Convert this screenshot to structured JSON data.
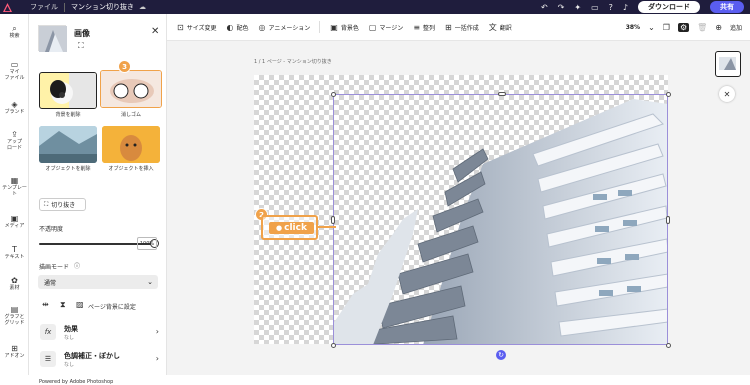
{
  "topbar": {
    "file_label": "ファイル",
    "doc_name": "マンション切り抜き",
    "download_label": "ダウンロード",
    "share_label": "共有"
  },
  "leftnav": [
    {
      "icon": "search-icon",
      "label": "検索"
    },
    {
      "icon": "folder-icon",
      "label": "マイ\nファイル"
    },
    {
      "icon": "brand-icon",
      "label": "ブランド"
    },
    {
      "icon": "upload-icon",
      "label": "アップ\nロード"
    },
    {
      "icon": "template-icon",
      "label": "テンプレート"
    },
    {
      "icon": "media-icon",
      "label": "メディア"
    },
    {
      "icon": "text-icon",
      "label": "テキスト"
    },
    {
      "icon": "elements-icon",
      "label": "素材"
    },
    {
      "icon": "grid-icon",
      "label": "グラフと\nグリッド"
    },
    {
      "icon": "addon-icon",
      "label": "アドオン"
    }
  ],
  "panel": {
    "title": "画像",
    "cards": [
      {
        "label": "背景を削除"
      },
      {
        "label": "消しゴム"
      },
      {
        "label": "オブジェクトを削除"
      },
      {
        "label": "オブジェクトを挿入"
      }
    ],
    "crop_label": "切り抜き",
    "opacity_label": "不透明度",
    "opacity_value": "100%",
    "blend_label": "描画モード",
    "blend_value": "通常",
    "bg_label": "ページ背景に設定",
    "effects_title": "効果",
    "effects_sub": "なし",
    "adjust_title": "色調補正・ぼかし",
    "adjust_sub": "なし",
    "powered": "Powered by Adobe Photoshop"
  },
  "toolbar": {
    "items": [
      "サイズ変更",
      "配色",
      "アニメーション",
      "背景色",
      "マージン",
      "整列",
      "一括作成",
      "翻訳"
    ],
    "zoom": "38%",
    "add_label": "追加"
  },
  "canvas": {
    "page_label": "1 / 1 ページ - マンション切り抜き",
    "click_label": "click"
  },
  "badges": {
    "step2": "2",
    "step3": "3"
  },
  "colors": {
    "accent": "#f0a24a",
    "brand": "#5a5df0",
    "topbar": "#1f1d3d"
  }
}
